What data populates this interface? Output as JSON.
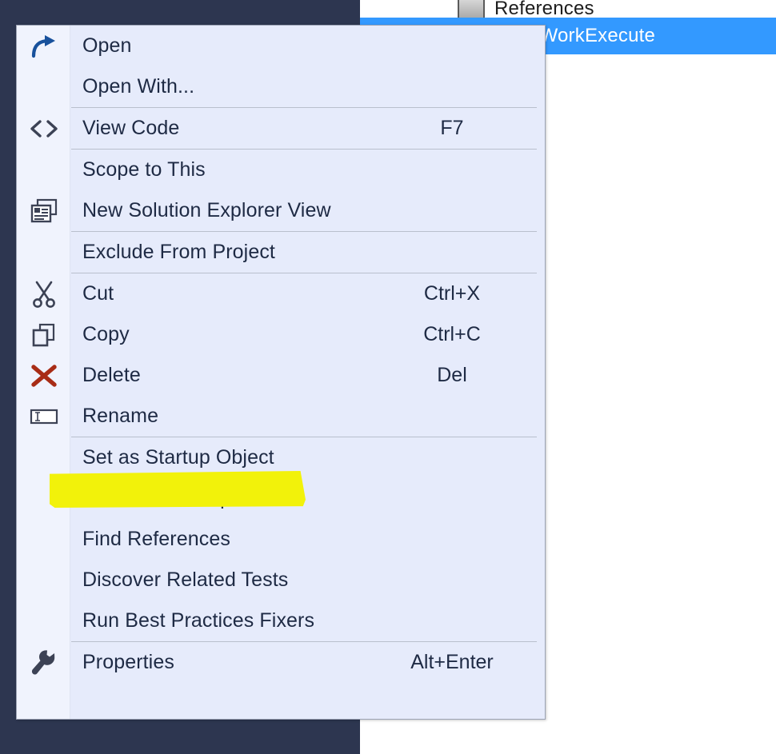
{
  "window": {
    "background_dark": "#2d3650",
    "background_light": "#ffffff"
  },
  "solution_explorer": {
    "items": [
      {
        "label": "References",
        "icon": "references-icon",
        "selected": false
      },
      {
        "label": "WHSWorkExecute",
        "icon": "class-file-icon",
        "selected": true
      }
    ],
    "selection_color": "#3399ff"
  },
  "context_menu": {
    "background": "#e6ebfb",
    "gutter_background": "#f0f3fd",
    "border_color": "#9ca3b4",
    "text_color": "#1e2a44",
    "items": [
      {
        "label": "Open",
        "shortcut": "",
        "icon": "open-arrow-icon",
        "separator_after": false
      },
      {
        "label": "Open With...",
        "shortcut": "",
        "icon": "",
        "separator_after": true
      },
      {
        "label": "View Code",
        "shortcut": "F7",
        "icon": "view-code-icon",
        "separator_after": true
      },
      {
        "label": "Scope to This",
        "shortcut": "",
        "icon": "",
        "separator_after": false
      },
      {
        "label": "New Solution Explorer View",
        "shortcut": "",
        "icon": "new-view-icon",
        "separator_after": true
      },
      {
        "label": "Exclude From Project",
        "shortcut": "",
        "icon": "",
        "separator_after": true
      },
      {
        "label": "Cut",
        "shortcut": "Ctrl+X",
        "icon": "scissors-icon",
        "separator_after": false
      },
      {
        "label": "Copy",
        "shortcut": "Ctrl+C",
        "icon": "copy-icon",
        "separator_after": false
      },
      {
        "label": "Delete",
        "shortcut": "Del",
        "icon": "delete-x-icon",
        "separator_after": false
      },
      {
        "label": "Rename",
        "shortcut": "",
        "icon": "rename-icon",
        "separator_after": true
      },
      {
        "label": "Set as Startup Object",
        "shortcut": "",
        "icon": "",
        "separator_after": false
      },
      {
        "label": "Advanced Compare...",
        "shortcut": "",
        "icon": "",
        "separator_after": false
      },
      {
        "label": "Find References",
        "shortcut": "",
        "icon": "",
        "separator_after": false
      },
      {
        "label": "Discover Related Tests",
        "shortcut": "",
        "icon": "",
        "separator_after": false
      },
      {
        "label": "Run Best Practices Fixers",
        "shortcut": "",
        "icon": "",
        "separator_after": true
      },
      {
        "label": "Properties",
        "shortcut": "Alt+Enter",
        "icon": "wrench-icon",
        "separator_after": false
      }
    ]
  },
  "annotation": {
    "type": "highlighter",
    "color": "#f2f20a",
    "targets_item": "Set as Startup Object"
  }
}
